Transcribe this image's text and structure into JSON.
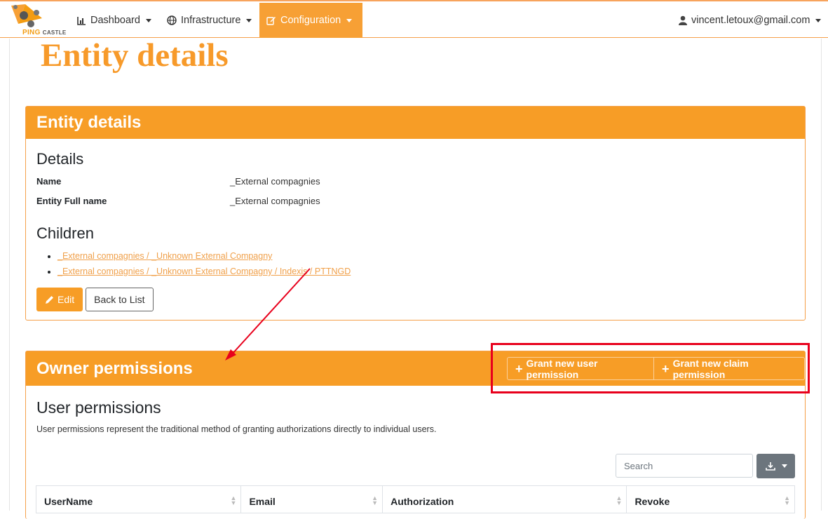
{
  "brand": {
    "name_ping": "PING",
    "name_castle": "CASTLE"
  },
  "nav": {
    "dashboard": "Dashboard",
    "infrastructure": "Infrastructure",
    "configuration": "Configuration",
    "user": "vincent.letoux@gmail.com"
  },
  "page": {
    "title": "Entity details"
  },
  "entity_card": {
    "header": "Entity details",
    "details_heading": "Details",
    "name_label": "Name",
    "name_value": "_External compagnies",
    "fullname_label": "Entity Full name",
    "fullname_value": "_External compagnies",
    "children_heading": "Children",
    "children": [
      "_External compagnies / _Unknown External Compagny",
      "_External compagnies / _Unknown External Compagny / Indexis / PTTNGD"
    ],
    "edit_label": "Edit",
    "back_label": "Back to List"
  },
  "owner_card": {
    "header": "Owner permissions",
    "grant_user": "Grant new user permission",
    "grant_claim": "Grant new claim permission",
    "user_permissions_heading": "User permissions",
    "description": "User permissions represent the traditional method of granting authorizations directly to individual users.",
    "search_placeholder": "Search",
    "columns": [
      "UserName",
      "Email",
      "Authorization",
      "Revoke"
    ]
  },
  "colors": {
    "accent": "#f79d26",
    "annotation": "#e8001c"
  }
}
